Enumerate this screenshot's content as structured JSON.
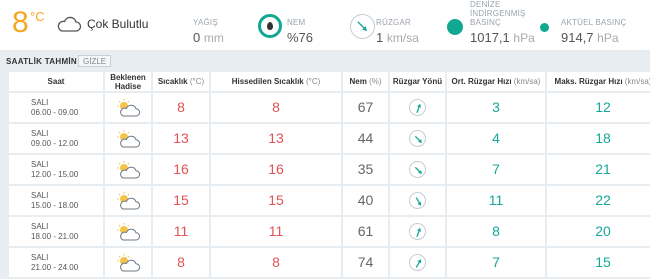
{
  "current": {
    "temperature": "8",
    "temp_unit": "°C",
    "condition": "Çok Bulutlu",
    "condition_icon": "cloud-icon",
    "precip_label": "YAĞIŞ",
    "precip_value": "0",
    "precip_unit": "mm",
    "humidity_label": "NEM",
    "humidity_value": "%76",
    "humidity_icon": "humidity-drop-icon",
    "wind_label": "RÜZGAR",
    "wind_value": "1",
    "wind_unit": "km/sa",
    "wind_icon": "wind-arrow-icon",
    "sea_pressure_label_1": "DENİZE",
    "sea_pressure_label_2": "İNDİRGENMİŞ",
    "sea_pressure_label_3": "BASINÇ",
    "sea_pressure_value": "1017,1",
    "sea_pressure_unit": "hPa",
    "actual_pressure_label": "AKTÜEL BASINÇ",
    "actual_pressure_value": "914,7",
    "actual_pressure_unit": "hPa",
    "accent_color": "#11a891",
    "temp_color": "#f5a623"
  },
  "hourly": {
    "title": "SAATLİK TAHMİN",
    "toggle_label": "GİZLE",
    "headers": {
      "time": "Saat",
      "expected_1": "Beklenen",
      "expected_2": "Hadise",
      "temp": "Sıcaklık",
      "temp_unit": "(°C)",
      "feels": "Hissedilen Sıcaklık",
      "feels_unit": "(°C)",
      "humidity": "Nem",
      "humidity_unit": "(%)",
      "wind_dir": "Rüzgar Yönü",
      "avg_wind": "Ort. Rüzgar Hızı",
      "avg_wind_unit": "(km/sa)",
      "max_wind": "Maks. Rüzgar Hızı",
      "max_wind_unit": "(km/sa)"
    },
    "rows": [
      {
        "day": "SALI",
        "range": "06.00 - 09.00",
        "icon": "partly-cloudy-icon",
        "temp": "8",
        "feels": "8",
        "humidity": "67",
        "wind_dir_deg": 200,
        "avg_wind": "3",
        "max_wind": "12"
      },
      {
        "day": "SALI",
        "range": "09.00 - 12.00",
        "icon": "partly-cloudy-icon",
        "temp": "13",
        "feels": "13",
        "humidity": "44",
        "wind_dir_deg": 315,
        "avg_wind": "4",
        "max_wind": "18"
      },
      {
        "day": "SALI",
        "range": "12.00 - 15.00",
        "icon": "partly-cloudy-icon",
        "temp": "16",
        "feels": "16",
        "humidity": "35",
        "wind_dir_deg": 315,
        "avg_wind": "7",
        "max_wind": "21"
      },
      {
        "day": "SALI",
        "range": "15.00 - 18.00",
        "icon": "partly-cloudy-icon",
        "temp": "15",
        "feels": "15",
        "humidity": "40",
        "wind_dir_deg": 330,
        "avg_wind": "11",
        "max_wind": "22"
      },
      {
        "day": "SALI",
        "range": "18.00 - 21.00",
        "icon": "partly-cloudy-icon",
        "temp": "11",
        "feels": "11",
        "humidity": "61",
        "wind_dir_deg": 200,
        "avg_wind": "8",
        "max_wind": "20"
      },
      {
        "day": "SALI",
        "range": "21.00 - 24.00",
        "icon": "partly-cloudy-icon",
        "temp": "8",
        "feels": "8",
        "humidity": "74",
        "wind_dir_deg": 210,
        "avg_wind": "7",
        "max_wind": "15"
      }
    ]
  }
}
